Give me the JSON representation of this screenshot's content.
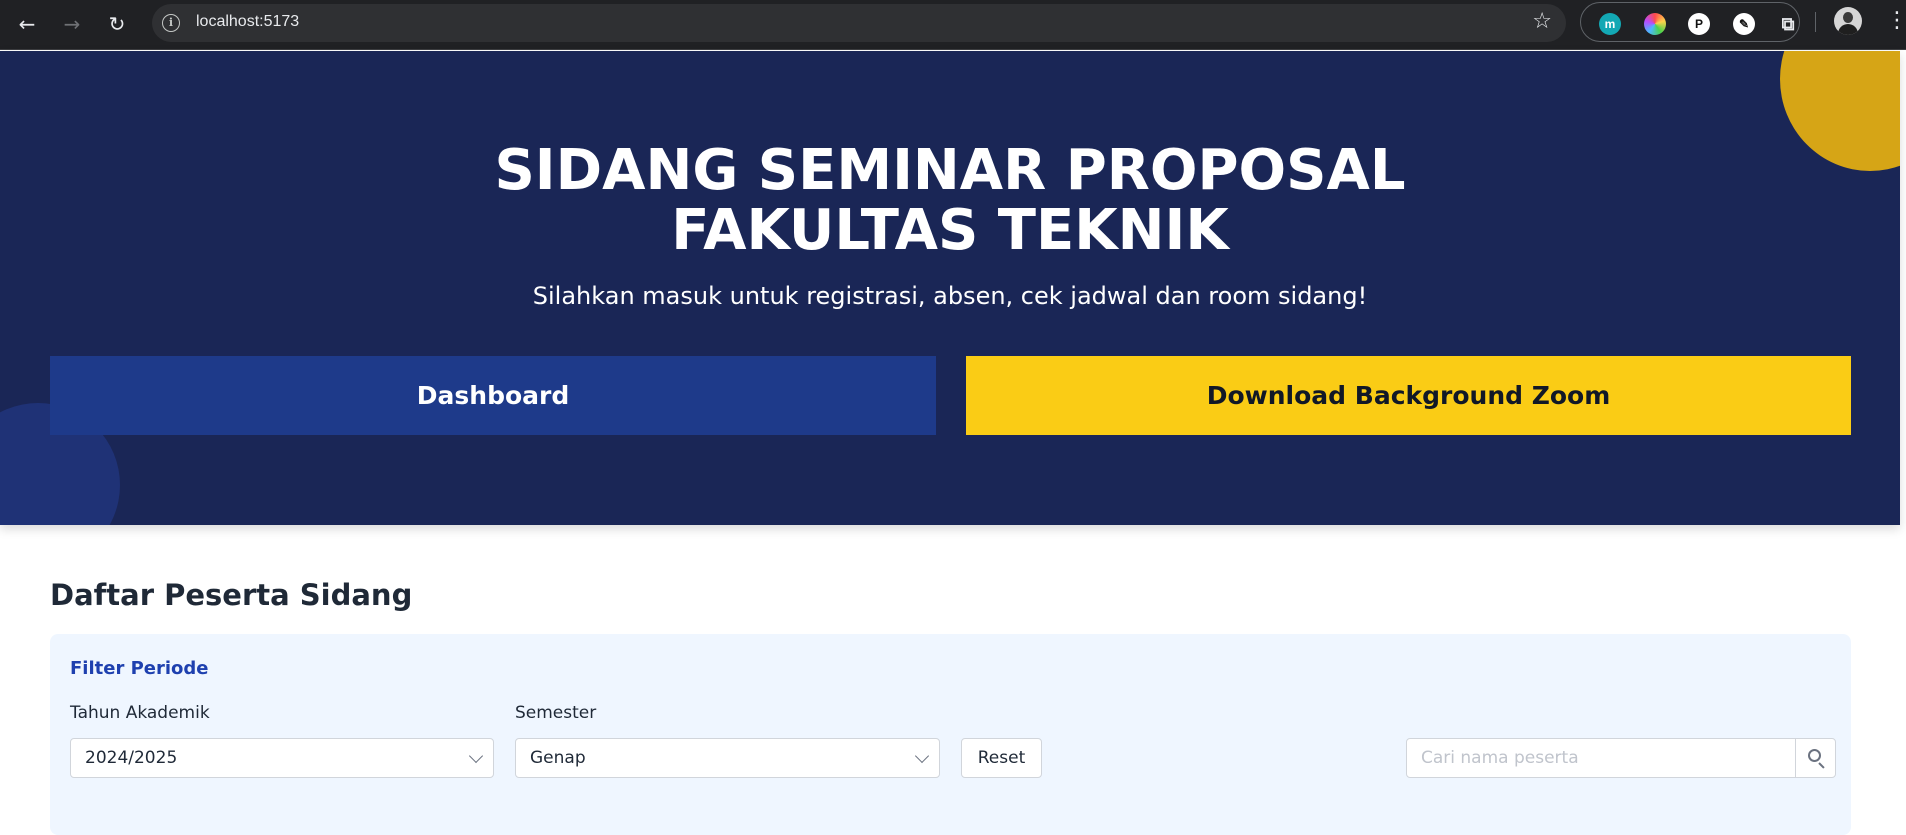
{
  "browser": {
    "url": "localhost:5173",
    "back_icon": "←",
    "forward_icon": "→",
    "reload_icon": "↻",
    "star_icon": "☆",
    "menu_icon": "⋮",
    "extensions": [
      {
        "name": "m-extension",
        "glyph": "m",
        "bg": "#13a8b4",
        "fg": "#ffffff"
      },
      {
        "name": "color-wheel-extension",
        "glyph": "",
        "bg": "conic-gradient(#ff4b4b,#ffd24b,#4bd24b,#4bb8ff,#b84bff,#ff4b4b)",
        "fg": "#ffffff"
      },
      {
        "name": "p-extension",
        "glyph": "P",
        "bg": "#ffffff",
        "fg": "#111111"
      },
      {
        "name": "eyedropper-extension",
        "glyph": "✎",
        "bg": "#ffffff",
        "fg": "#111111"
      },
      {
        "name": "puzzle-extension",
        "glyph": "⧉",
        "bg": "transparent",
        "fg": "#e8eaed"
      }
    ]
  },
  "hero": {
    "title_line1": "SIDANG SEMINAR PROPOSAL",
    "title_line2": "FAKULTAS TEKNIK",
    "subtitle": "Silahkan masuk untuk registrasi, absen, cek jadwal dan room sidang!",
    "dashboard_label": "Dashboard",
    "download_label": "Download Background Zoom"
  },
  "participants": {
    "heading": "Daftar Peserta Sidang",
    "filter": {
      "title": "Filter Periode",
      "year_label": "Tahun Akademik",
      "year_value": "2024/2025",
      "semester_label": "Semester",
      "semester_value": "Genap",
      "reset_label": "Reset",
      "search_placeholder": "Cari nama peserta"
    }
  }
}
